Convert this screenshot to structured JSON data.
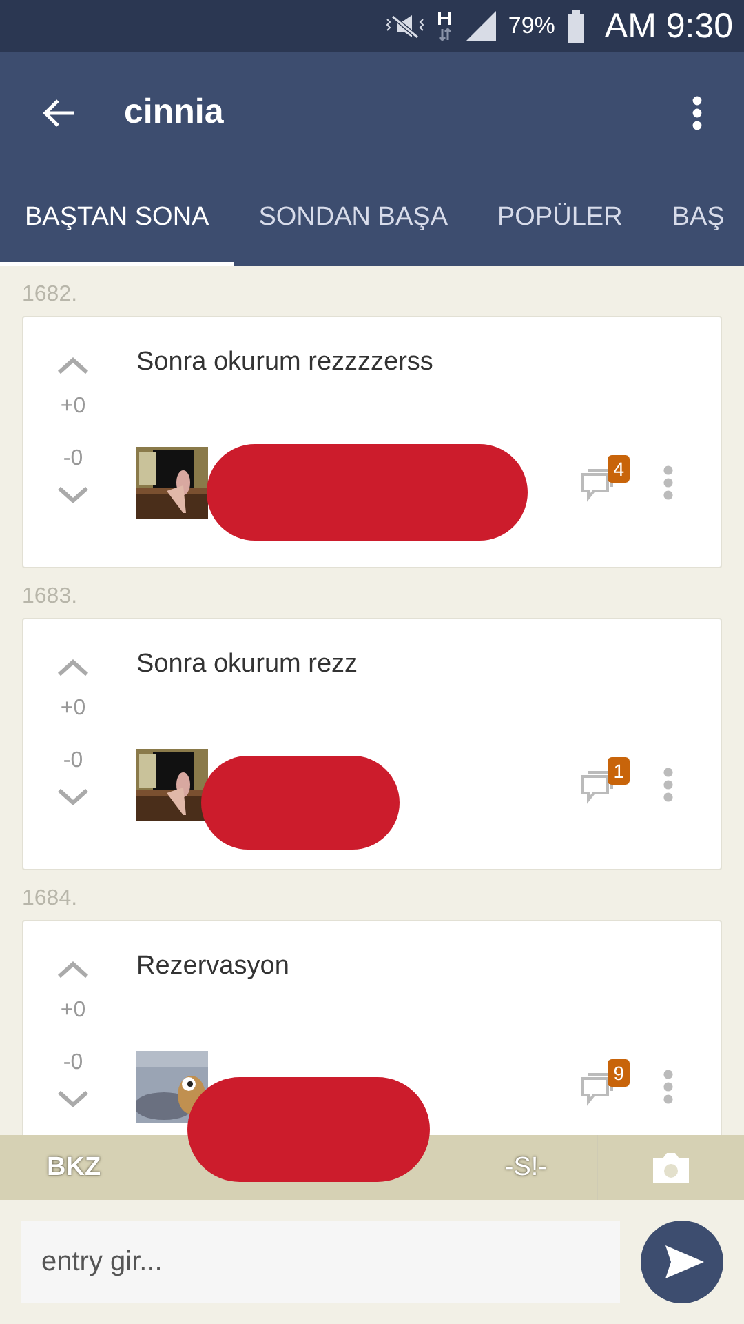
{
  "status_bar": {
    "battery": "79%",
    "time": "AM 9:30"
  },
  "app_bar": {
    "title": "cinnia"
  },
  "tabs": [
    {
      "label": "BAŞTAN SONA",
      "selected": true
    },
    {
      "label": "SONDAN BAŞA",
      "selected": false
    },
    {
      "label": "POPÜLER",
      "selected": false
    },
    {
      "label": "BAŞ",
      "selected": false
    }
  ],
  "entries": [
    {
      "number": "1682.",
      "text": "Sonra okurum rezzzzerss",
      "plus": "+0",
      "minus": "-0",
      "comments": "4",
      "redacted": true
    },
    {
      "number": "1683.",
      "text": "Sonra okurum rezz",
      "plus": "+0",
      "minus": "-0",
      "comments": "1",
      "redacted": true
    },
    {
      "number": "1684.",
      "text": "Rezervasyon",
      "plus": "+0",
      "minus": "-0",
      "comments": "9",
      "redacted": true
    }
  ],
  "toolbar": {
    "bkz": "BKZ",
    "spoiler": "-S!-"
  },
  "composer": {
    "placeholder": "entry gir..."
  }
}
